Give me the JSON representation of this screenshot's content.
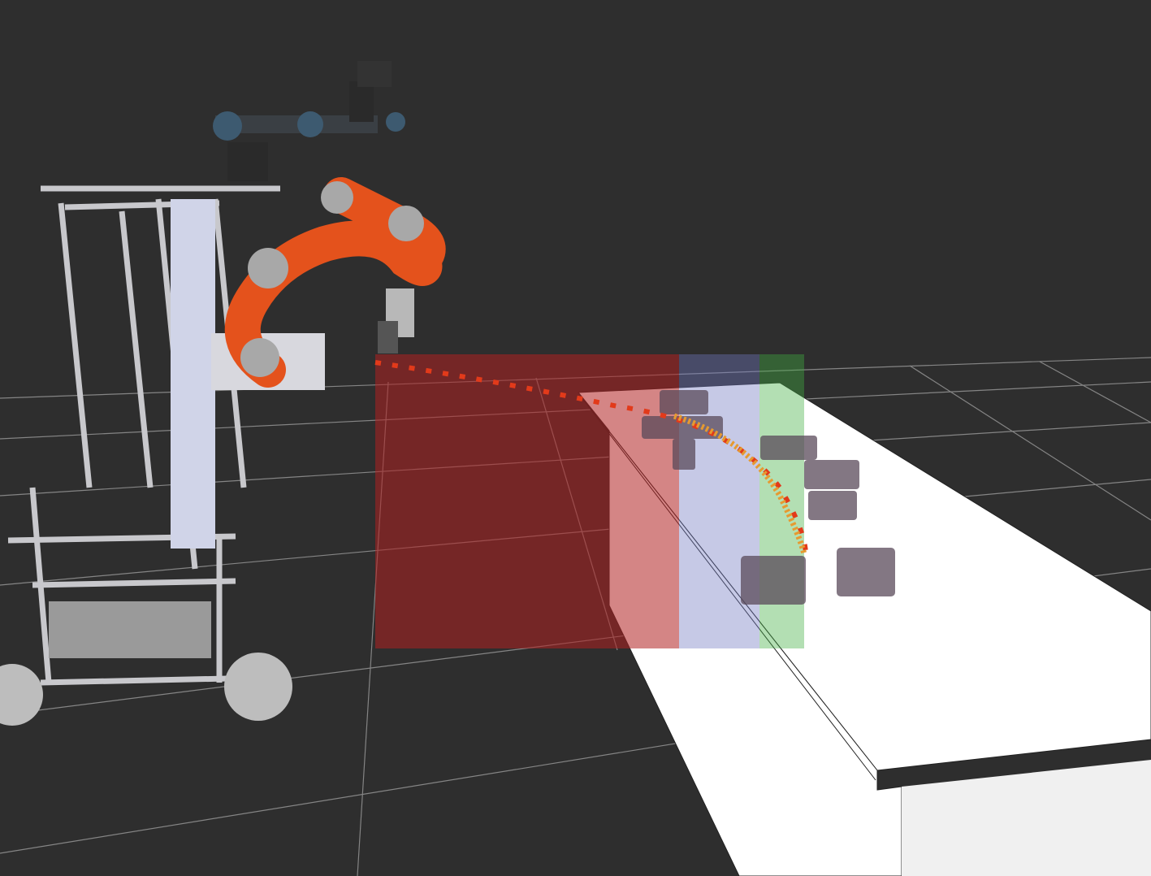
{
  "viewport": {
    "background_color": "#2e2e2e",
    "grid_color": "#8a8a8a",
    "table_color": "#ffffff",
    "table_side_color": "#f0f0f0"
  },
  "regions": [
    {
      "name": "red-region",
      "color": "#b02020"
    },
    {
      "name": "blue-region",
      "color": "#7078c0"
    },
    {
      "name": "green-region",
      "color": "#40b040"
    }
  ],
  "robots": {
    "arm_color": "#e4521c",
    "joint_color": "#a8a8a8",
    "ur_arm_color": "#3a3f44",
    "frame_color": "#c8c8cc"
  },
  "trajectory": {
    "color": "#e23a1a"
  }
}
